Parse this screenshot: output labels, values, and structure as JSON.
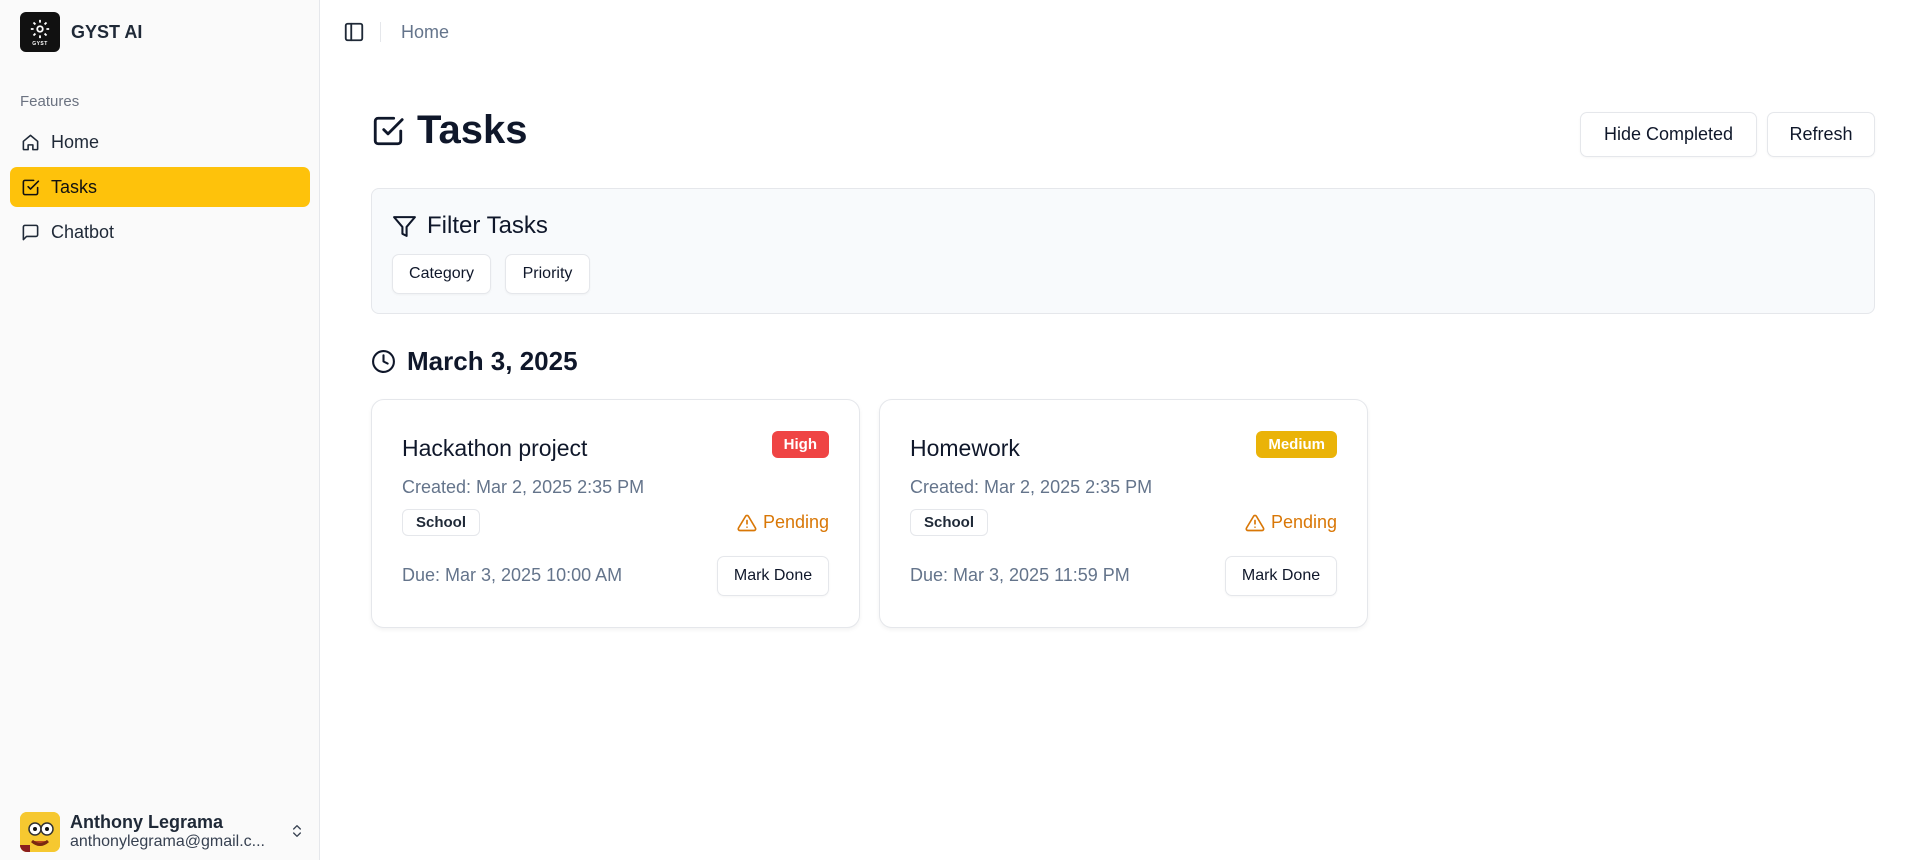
{
  "app": {
    "name": "GYST AI",
    "logo_text": "GYST"
  },
  "sidebar": {
    "section_label": "Features",
    "items": [
      {
        "label": "Home",
        "icon": "home-icon",
        "active": false
      },
      {
        "label": "Tasks",
        "icon": "check-square-icon",
        "active": true
      },
      {
        "label": "Chatbot",
        "icon": "message-square-icon",
        "active": false
      }
    ],
    "user": {
      "name": "Anthony Legrama",
      "email": "anthonylegrama@gmail.c..."
    }
  },
  "header": {
    "breadcrumb": "Home"
  },
  "page": {
    "title": "Tasks",
    "hide_completed_label": "Hide Completed",
    "refresh_label": "Refresh"
  },
  "filter": {
    "title": "Filter Tasks",
    "chips": {
      "category": "Category",
      "priority": "Priority"
    }
  },
  "groups": [
    {
      "date": "March 3, 2025",
      "tasks": [
        {
          "title": "Hackathon project",
          "priority": "High",
          "priority_color": "#ef4444",
          "created": "Created: Mar 2, 2025 2:35 PM",
          "category": "School",
          "status": "Pending",
          "due": "Due: Mar 3, 2025 10:00 AM",
          "action": "Mark Done"
        },
        {
          "title": "Homework",
          "priority": "Medium",
          "priority_color": "#eab308",
          "created": "Created: Mar 2, 2025 2:35 PM",
          "category": "School",
          "status": "Pending",
          "due": "Due: Mar 3, 2025 11:59 PM",
          "action": "Mark Done"
        }
      ]
    }
  ],
  "colors": {
    "accent": "#fec20b",
    "pending": "#d97706"
  }
}
